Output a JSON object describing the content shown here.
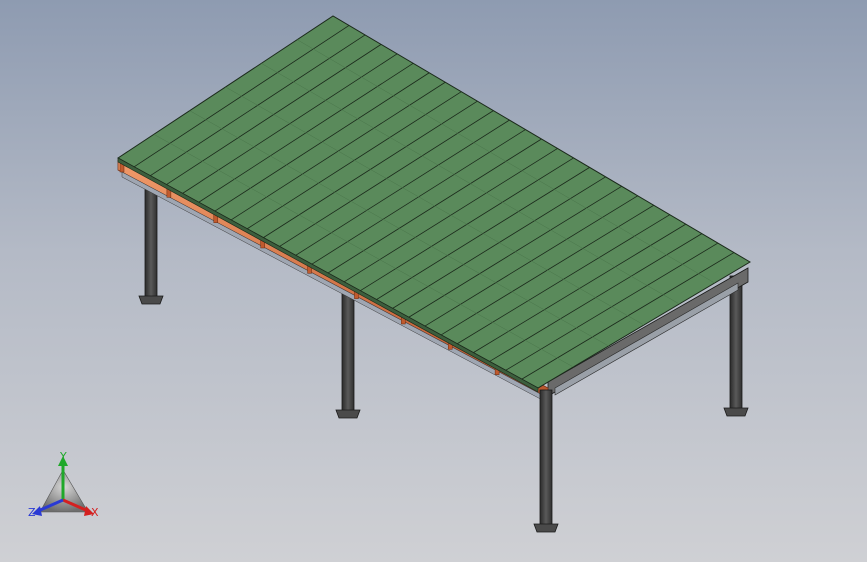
{
  "viewport": {
    "background_top": "#8e9bb1",
    "background_bottom": "#cfd0d4"
  },
  "model": {
    "roof_color": "#5a8a5b",
    "roof_line_color": "#1b2a1b",
    "gutter_color": "#e07a4a",
    "column_color": "#3d3d3d",
    "roof_panel_count": 26
  },
  "triad": {
    "x_label": "X",
    "y_label": "Y",
    "z_label": "Z",
    "x_color": "#d42020",
    "y_color": "#1fa82a",
    "z_color": "#2a3ad4"
  }
}
